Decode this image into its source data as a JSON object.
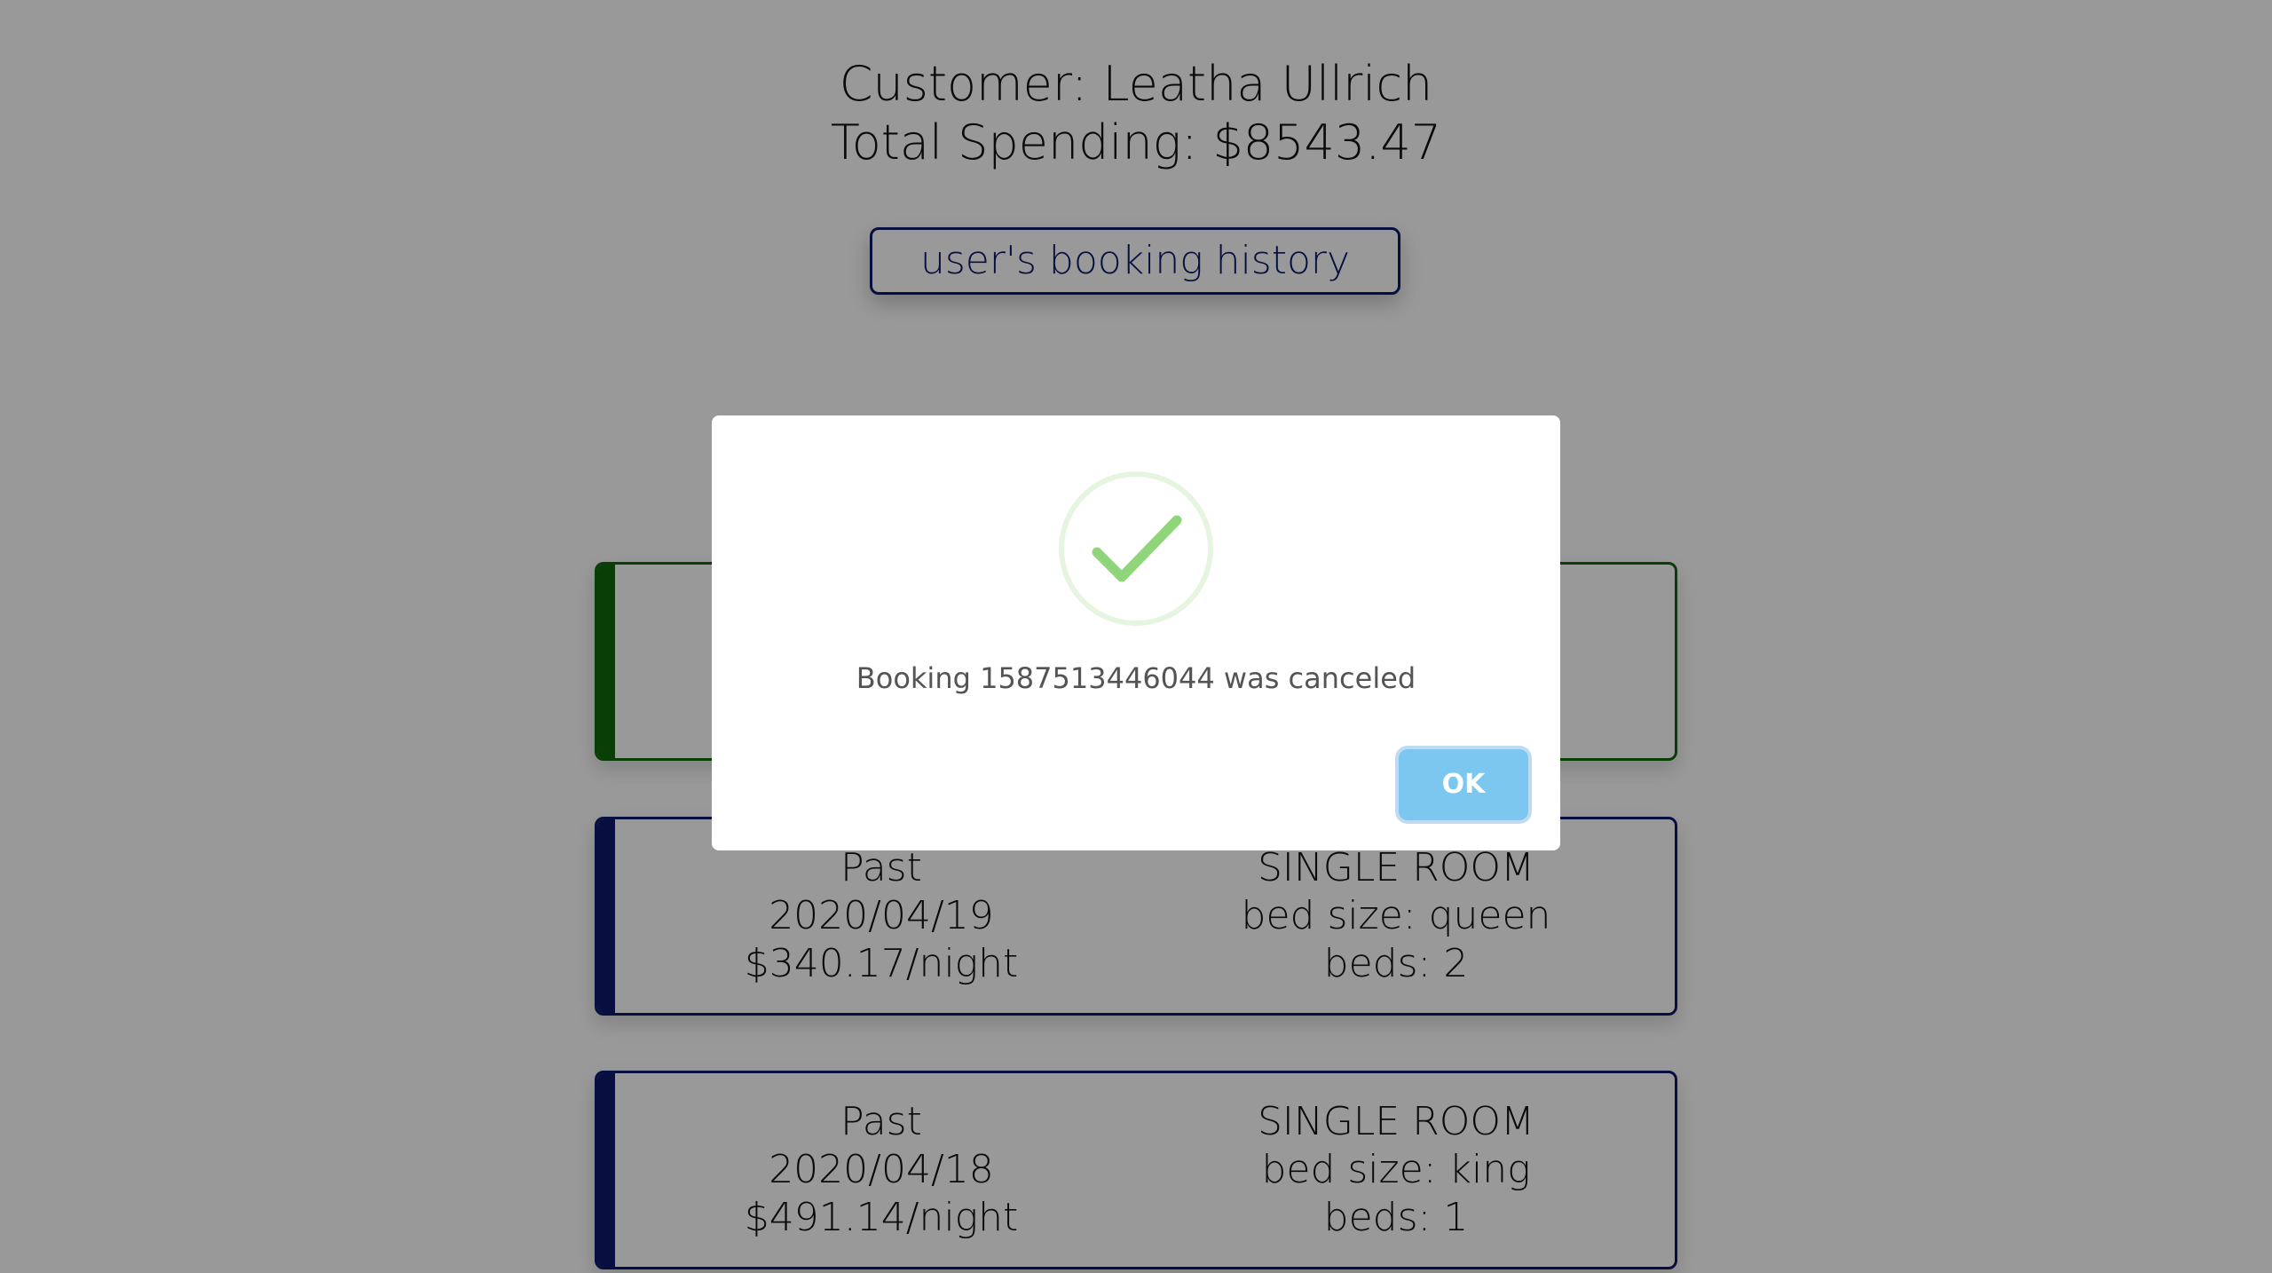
{
  "header": {
    "customer_line": "Customer: Leatha Ullrich",
    "spending_line": "Total Spending: $8543.47"
  },
  "history_button": {
    "label": "user's booking history"
  },
  "bookings": [
    {
      "status": "",
      "date": "",
      "price": "",
      "room_type": "",
      "bed_size": "",
      "beds": "",
      "accent_color": "#0f6a0c"
    },
    {
      "status": "Past",
      "date": "2020/04/19",
      "price": "$340.17/night",
      "room_type": "SINGLE ROOM",
      "bed_size": "bed size: queen",
      "beds": "beds: 2",
      "accent_color": "#0b1a6b"
    },
    {
      "status": "Past",
      "date": "2020/04/18",
      "price": "$491.14/night",
      "room_type": "SINGLE ROOM",
      "bed_size": "bed size: king",
      "beds": "beds: 1",
      "accent_color": "#0b1a6b"
    }
  ],
  "modal": {
    "icon": "success-check-icon",
    "message": "Booking 1587513446044 was canceled",
    "ok_label": "OK"
  },
  "colors": {
    "overlay": "rgba(0,0,0,0.40)",
    "success_green": "#8fd67a",
    "success_ring": "#e6f5df",
    "ok_button": "#7cc7ef",
    "navy": "#0b1a6b"
  }
}
